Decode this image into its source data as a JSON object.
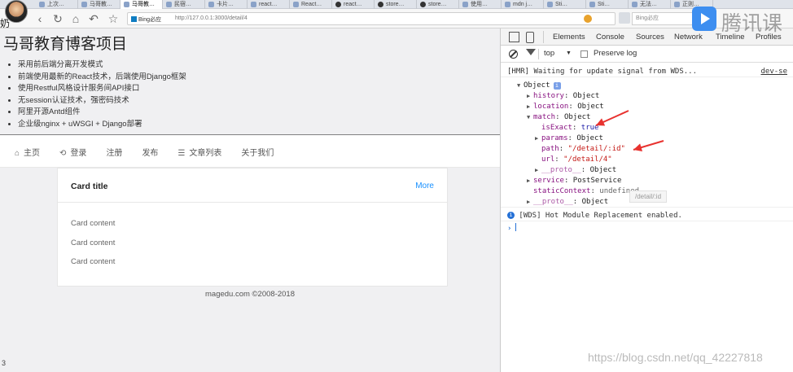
{
  "browser": {
    "tabs": [
      {
        "label": "上次…",
        "active": false,
        "kind": "page"
      },
      {
        "label": "马哥教…",
        "active": false,
        "kind": "page"
      },
      {
        "label": "马哥教…",
        "active": true,
        "kind": "page"
      },
      {
        "label": "民宿…",
        "active": false,
        "kind": "page"
      },
      {
        "label": "卡片…",
        "active": false,
        "kind": "page"
      },
      {
        "label": "react…",
        "active": false,
        "kind": "page"
      },
      {
        "label": "React…",
        "active": false,
        "kind": "page"
      },
      {
        "label": "react…",
        "active": false,
        "kind": "github"
      },
      {
        "label": "store…",
        "active": false,
        "kind": "github"
      },
      {
        "label": "store…",
        "active": false,
        "kind": "github"
      },
      {
        "label": "使用…",
        "active": false,
        "kind": "page"
      },
      {
        "label": "mdn j…",
        "active": false,
        "kind": "page"
      },
      {
        "label": "Sti…",
        "active": false,
        "kind": "page"
      },
      {
        "label": "Sti…",
        "active": false,
        "kind": "page"
      },
      {
        "label": "无法…",
        "active": false,
        "kind": "page"
      },
      {
        "label": "正则…",
        "active": false,
        "kind": "page"
      }
    ],
    "url_engine": "Bing必应",
    "url": "http://127.0.0.1:3000/detail/4",
    "search_placeholder": "Bing必应"
  },
  "left_glyph": "奶",
  "page": {
    "title": "马哥教育博客项目",
    "features": [
      "采用前后端分离开发模式",
      "前端使用最新的React技术，后端使用Django框架",
      "使用Restful风格设计服务间API接口",
      "无session认证技术，强密码技术",
      "阿里开源Antd组件",
      "企业级nginx + uWSGI + Django部署"
    ],
    "menu": [
      {
        "label": "主页",
        "icon": "home-icon",
        "glyph": "⌂"
      },
      {
        "label": "登录",
        "icon": "login-icon",
        "glyph": "⟲"
      },
      {
        "label": "注册",
        "icon": "",
        "glyph": ""
      },
      {
        "label": "发布",
        "icon": "",
        "glyph": ""
      },
      {
        "label": "文章列表",
        "icon": "list-icon",
        "glyph": "☰"
      },
      {
        "label": "关于我们",
        "icon": "",
        "glyph": ""
      }
    ],
    "card": {
      "title": "Card title",
      "more": "More",
      "contents": [
        "Card content",
        "Card content",
        "Card content"
      ]
    },
    "footer": "magedu.com ©2008-2018",
    "corner_digit": "3"
  },
  "devtools": {
    "tabs": [
      "Elements",
      "Console",
      "Sources",
      "Network",
      "Timeline",
      "Profiles"
    ],
    "context": "top",
    "preserve_log": "Preserve log",
    "console": {
      "hmr_text": "[HMR] Waiting for update signal from WDS...",
      "hmr_link": "dev-se",
      "object_label": "Object",
      "props": {
        "history": {
          "key": "history",
          "value": "Object"
        },
        "location": {
          "key": "location",
          "value": "Object"
        },
        "match": {
          "key": "match",
          "value": "Object"
        },
        "isExact": {
          "key": "isExact",
          "value": "true"
        },
        "params": {
          "key": "params",
          "value": "Object"
        },
        "path": {
          "key": "path",
          "value": "\"/detail/:id\""
        },
        "url": {
          "key": "url",
          "value": "\"/detail/4\""
        },
        "proto_inner": {
          "key": "__proto__",
          "value": "Object"
        },
        "service": {
          "key": "service",
          "value": "PostService"
        },
        "staticContext": {
          "key": "staticContext",
          "value": "undefined"
        },
        "proto_outer": {
          "key": "__proto__",
          "value": "Object"
        }
      },
      "tooltip": "/detail/:id",
      "wds_text": "[WDS] Hot Module Replacement enabled."
    }
  },
  "overlays": {
    "brand_watermark": "腾讯课",
    "url_watermark": "https://blog.csdn.net/qq_42227818",
    "arrow_color": "#e8322f"
  }
}
